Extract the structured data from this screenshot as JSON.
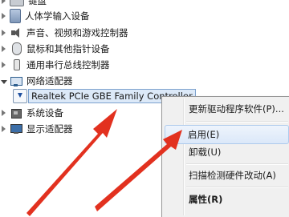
{
  "tree": {
    "items": [
      {
        "label": "键盘",
        "icon": "keyboard-icon"
      },
      {
        "label": "人体学输入设备",
        "icon": "hid-icon"
      },
      {
        "label": "声音、视频和游戏控制器",
        "icon": "speaker-icon"
      },
      {
        "label": "鼠标和其他指针设备",
        "icon": "mouse-icon"
      },
      {
        "label": "通用串行总线控制器",
        "icon": "usb-icon"
      },
      {
        "label": "网络适配器",
        "icon": "network-adapter-icon"
      },
      {
        "label": "Realtek PCIe GBE Family Controller",
        "icon": "network-card-icon"
      },
      {
        "label": "系统设备",
        "icon": "chip-icon"
      },
      {
        "label": "显示适配器",
        "icon": "display-icon"
      }
    ]
  },
  "context_menu": {
    "items": [
      {
        "label": "更新驱动程序软件(P)..."
      },
      {
        "label": "启用(E)"
      },
      {
        "label": "卸载(U)"
      },
      {
        "label": "扫描检测硬件改动(A)"
      },
      {
        "label": "属性(R)"
      }
    ]
  },
  "colors": {
    "arrow": "#e2311f",
    "selection": "#dce9f8",
    "menu_background": "#f0f0f0"
  }
}
